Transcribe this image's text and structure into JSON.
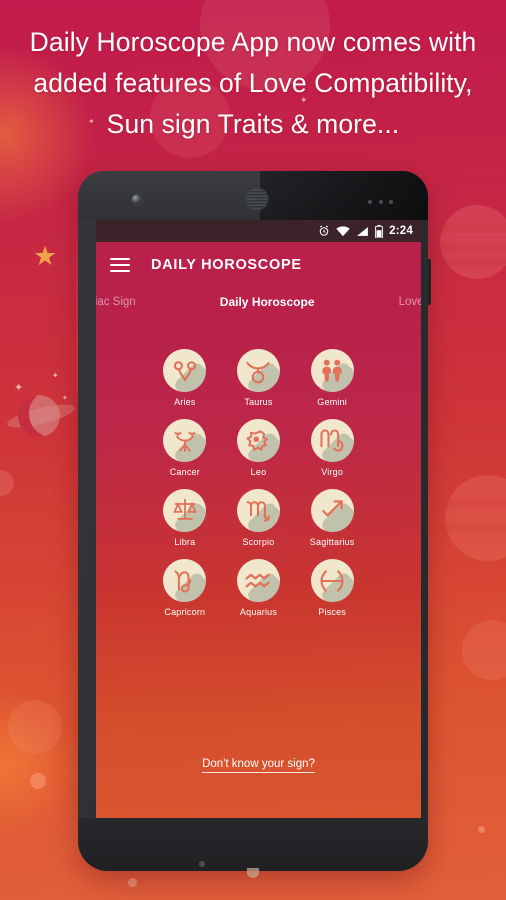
{
  "promo": {
    "headline_lines": [
      "Daily Horoscope App now comes with",
      "added features of Love Compatibility,",
      "Sun sign Traits & more..."
    ]
  },
  "phone": {
    "status_bar": {
      "time": "2:24",
      "icons": [
        "alarm-icon",
        "wifi-icon",
        "signal-icon",
        "battery-icon"
      ]
    },
    "app_bar": {
      "menu_icon": "hamburger-menu-icon",
      "title": "DAILY HOROSCOPE"
    },
    "tabs": [
      {
        "label": "odiac Sign",
        "active": false
      },
      {
        "label": "Daily Horoscope",
        "active": true
      },
      {
        "label": "Love Com",
        "active": false
      }
    ],
    "zodiac_signs": [
      {
        "name": "Aries",
        "icon": "aries-icon"
      },
      {
        "name": "Taurus",
        "icon": "taurus-icon"
      },
      {
        "name": "Gemini",
        "icon": "gemini-icon"
      },
      {
        "name": "Cancer",
        "icon": "cancer-icon"
      },
      {
        "name": "Leo",
        "icon": "leo-icon"
      },
      {
        "name": "Virgo",
        "icon": "virgo-icon"
      },
      {
        "name": "Libra",
        "icon": "libra-icon"
      },
      {
        "name": "Scorpio",
        "icon": "scorpio-icon"
      },
      {
        "name": "Sagittarius",
        "icon": "sagittarius-icon"
      },
      {
        "name": "Capricorn",
        "icon": "capricorn-icon"
      },
      {
        "name": "Aquarius",
        "icon": "aquarius-icon"
      },
      {
        "name": "Pisces",
        "icon": "pisces-icon"
      }
    ],
    "help_link": "Don't know your sign?",
    "nav_bar": {
      "back": "back-triangle-icon",
      "home": "home-circle-icon",
      "recents": "recents-square-icon"
    }
  },
  "colors": {
    "bg_top": "#c21b4d",
    "bg_bottom": "#e1603a",
    "app_bar": "#b9214a",
    "screen_top": "#b7214b",
    "screen_bottom": "#d9562f",
    "disc": "#f1e7cd",
    "glyph": "#e2705a",
    "disc_shadow": "#b8bba6",
    "status_bar": "#3c2329",
    "text": "#ffffff"
  }
}
